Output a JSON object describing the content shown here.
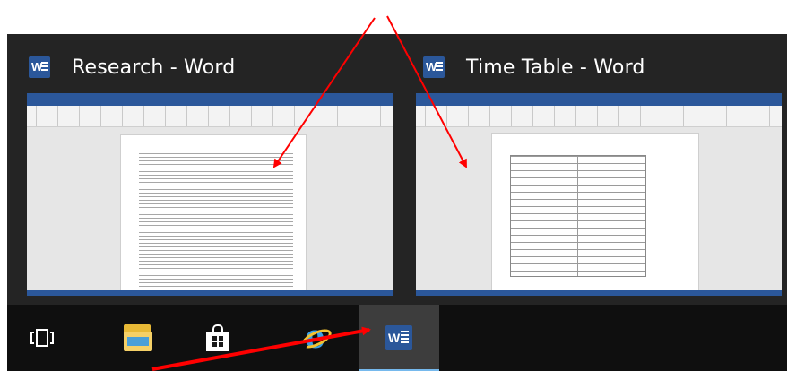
{
  "thumbnails": [
    {
      "title": "Research - Word",
      "icon": "word-icon"
    },
    {
      "title": "Time Table - Word",
      "icon": "word-icon"
    }
  ],
  "taskbar": {
    "items": [
      {
        "name": "task-view",
        "icon": "task-view-icon"
      },
      {
        "name": "file-explorer",
        "icon": "folder-icon"
      },
      {
        "name": "store",
        "icon": "store-icon"
      },
      {
        "name": "internet-explorer",
        "icon": "internet-explorer-icon"
      },
      {
        "name": "word",
        "icon": "word-icon",
        "active": true
      }
    ]
  },
  "colors": {
    "word_blue": "#2b579a",
    "flyout_bg": "#242424",
    "taskbar_bg": "#0f0f0f",
    "arrow_red": "#ff0000"
  }
}
